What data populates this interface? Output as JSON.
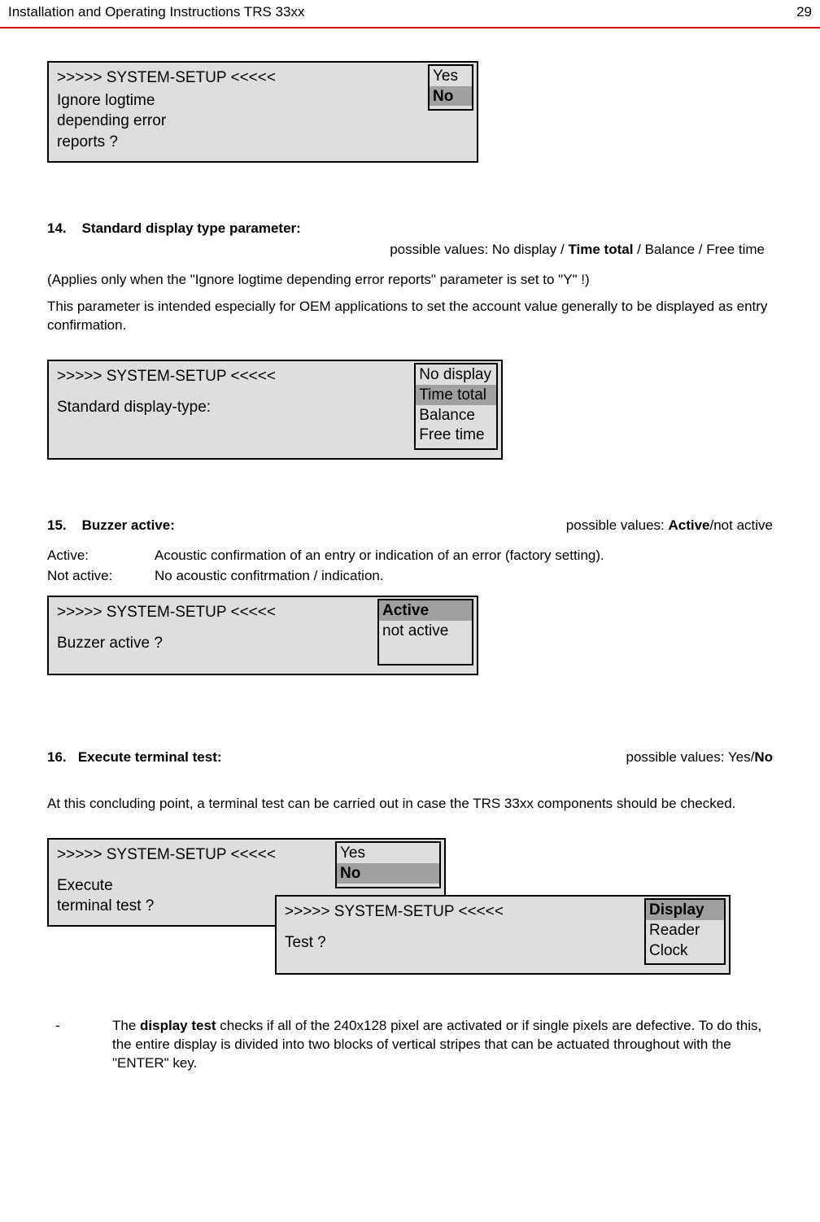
{
  "header": {
    "title": "Installation and Operating Instructions TRS 33xx",
    "page": "29"
  },
  "panel1": {
    "title": ">>>>> SYSTEM-SETUP <<<<<",
    "line1": "Ignore logtime",
    "line2": "depending error",
    "line3": "reports ?",
    "opt1": "Yes",
    "opt2": "No"
  },
  "sec14": {
    "num": "14.",
    "title": "Standard display type parameter:",
    "values_prefix": "possible values: No display / ",
    "values_bold": "Time total",
    "values_suffix": " / Balance / Free time",
    "para1": "(Applies only when the \"Ignore logtime depending error reports\" parameter is set to \"Y\" !)",
    "para2": "This parameter is intended especially for OEM applications to set the account value generally to be displayed as entry confirmation."
  },
  "panel2": {
    "title": ">>>>> SYSTEM-SETUP <<<<<",
    "line1": "Standard display-type:",
    "opt1": "No display",
    "opt2": "Time total",
    "opt3": "Balance",
    "opt4": "Free time"
  },
  "sec15": {
    "num": "15.",
    "title": "Buzzer active:",
    "values_prefix": "possible values: ",
    "values_bold": "Active",
    "values_suffix": "/not active",
    "row1_label": "Active:",
    "row1_val": "Acoustic confirmation of an entry or indication of an error (factory setting).",
    "row2_label": "Not active:",
    "row2_val": "No acoustic confitrmation / indication."
  },
  "panel3": {
    "title": ">>>>> SYSTEM-SETUP <<<<<",
    "line1": "Buzzer active ?",
    "opt1": "Active",
    "opt2": "not active"
  },
  "sec16": {
    "num": "16.",
    "title": "Execute terminal test:",
    "values_prefix": "possible values: Yes/",
    "values_bold": "No",
    "para1": "At this concluding point, a terminal test can be carried out in case the TRS 33xx components should be checked."
  },
  "panel4": {
    "title": ">>>>> SYSTEM-SETUP <<<<<",
    "line1": "Execute",
    "line2": "terminal test ?",
    "opt1": "Yes",
    "opt2": "No"
  },
  "panel5": {
    "title": ">>>>> SYSTEM-SETUP <<<<<",
    "line1": "Test ?",
    "opt1": "Display",
    "opt2": "Reader",
    "opt3": "Clock"
  },
  "bullet": {
    "dash": "-",
    "pre": "The ",
    "bold": "display test",
    "post": " checks if all of the 240x128 pixel are activated or if single pixels are defective. To do this, the entire display is divided into two blocks of vertical stripes that can be actuated throughout with the \"ENTER\" key."
  }
}
